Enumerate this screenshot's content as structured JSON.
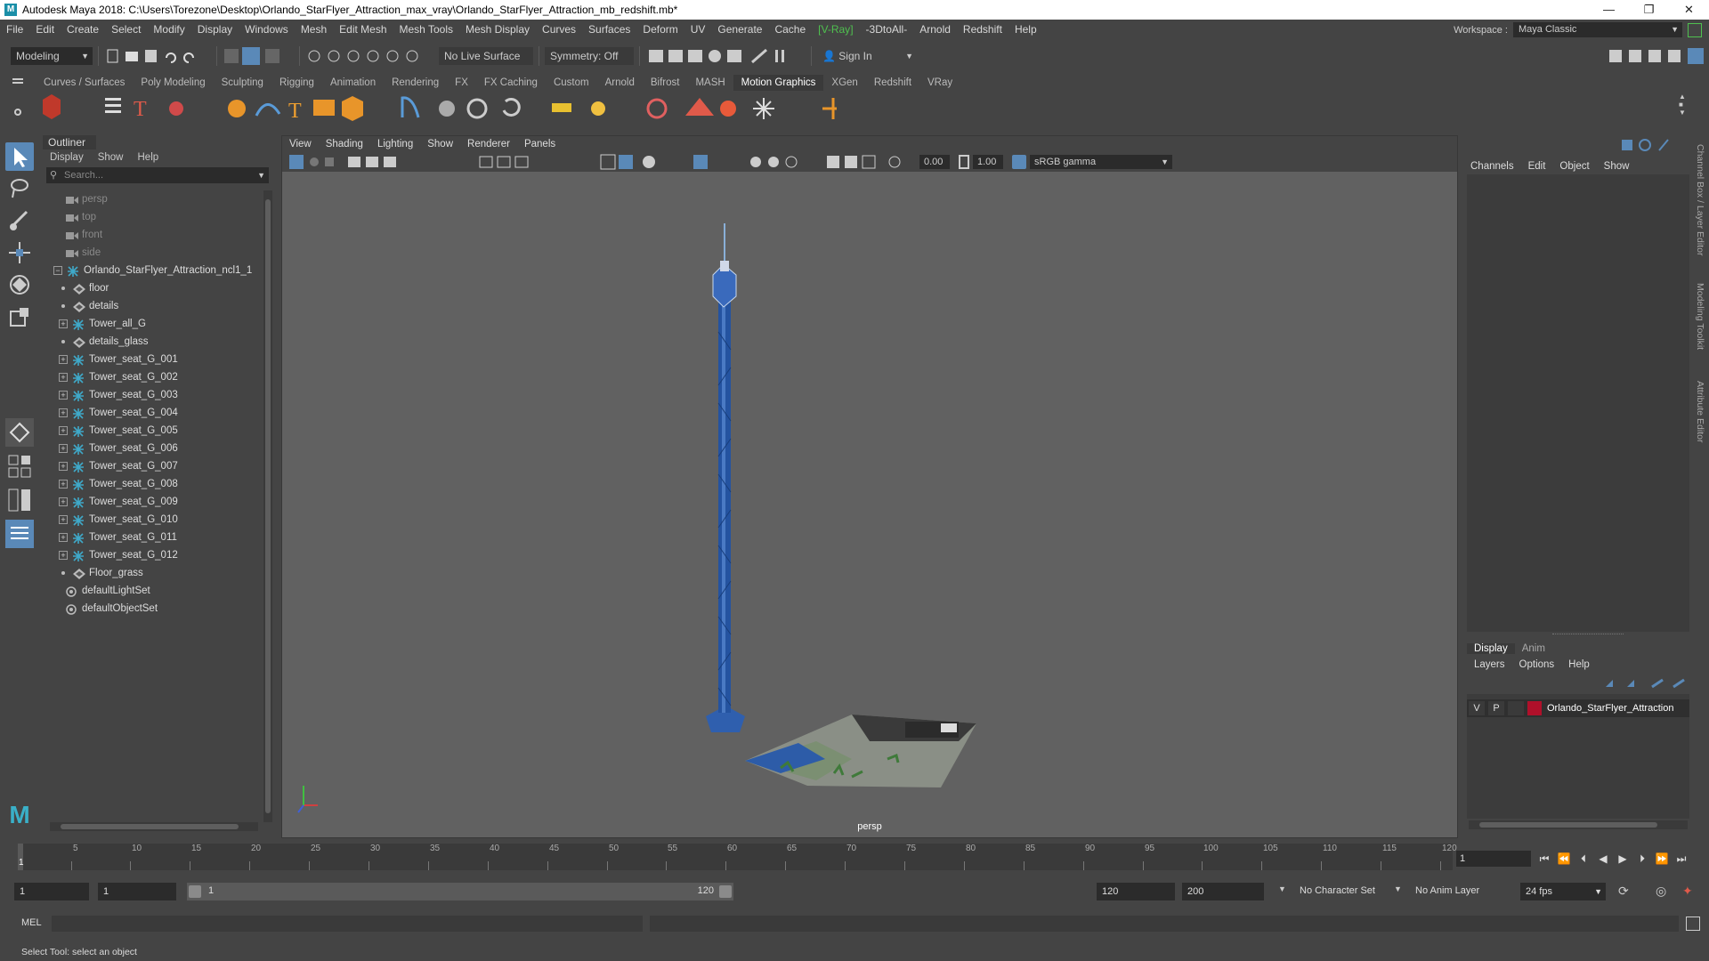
{
  "window": {
    "title": "Autodesk Maya 2018: C:\\Users\\Torezone\\Desktop\\Orlando_StarFlyer_Attraction_max_vray\\Orlando_StarFlyer_Attraction_mb_redshift.mb*",
    "minimize": "—",
    "maximize": "❐",
    "close": "✕"
  },
  "menubar": {
    "items": [
      "File",
      "Edit",
      "Create",
      "Select",
      "Modify",
      "Display",
      "Windows",
      "Mesh",
      "Edit Mesh",
      "Mesh Tools",
      "Mesh Display",
      "Curves",
      "Surfaces",
      "Deform",
      "UV",
      "Generate",
      "Cache",
      "-3DtoAll-",
      "Arnold",
      "Redshift",
      "Help"
    ],
    "vray": "V-Ray",
    "workspace_label": "Workspace :",
    "workspace_value": "Maya Classic"
  },
  "statusline": {
    "mode": "Modeling",
    "live_surface": "No Live Surface",
    "symmetry": "Symmetry: Off",
    "sign_in": "Sign In"
  },
  "shelf": {
    "tabs": [
      "Curves / Surfaces",
      "Poly Modeling",
      "Sculpting",
      "Rigging",
      "Animation",
      "Rendering",
      "FX",
      "FX Caching",
      "Custom",
      "Arnold",
      "Bifrost",
      "MASH",
      "Motion Graphics",
      "XGen",
      "Redshift",
      "VRay"
    ],
    "active_tab": "Motion Graphics"
  },
  "outliner": {
    "title": "Outliner",
    "menu": [
      "Display",
      "Show",
      "Help"
    ],
    "search_placeholder": "Search...",
    "items": [
      {
        "label": "persp",
        "type": "camera",
        "dim": true
      },
      {
        "label": "top",
        "type": "camera",
        "dim": true
      },
      {
        "label": "front",
        "type": "camera",
        "dim": true
      },
      {
        "label": "side",
        "type": "camera",
        "dim": true
      },
      {
        "label": "Orlando_StarFlyer_Attraction_ncl1_1",
        "type": "group",
        "expand": "−"
      },
      {
        "label": "floor",
        "type": "mesh",
        "child": true
      },
      {
        "label": "details",
        "type": "mesh",
        "child": true
      },
      {
        "label": "Tower_all_G",
        "type": "group",
        "child": true,
        "expand": "+"
      },
      {
        "label": "details_glass",
        "type": "mesh",
        "child": true
      },
      {
        "label": "Tower_seat_G_001",
        "type": "group",
        "child": true,
        "expand": "+"
      },
      {
        "label": "Tower_seat_G_002",
        "type": "group",
        "child": true,
        "expand": "+"
      },
      {
        "label": "Tower_seat_G_003",
        "type": "group",
        "child": true,
        "expand": "+"
      },
      {
        "label": "Tower_seat_G_004",
        "type": "group",
        "child": true,
        "expand": "+"
      },
      {
        "label": "Tower_seat_G_005",
        "type": "group",
        "child": true,
        "expand": "+"
      },
      {
        "label": "Tower_seat_G_006",
        "type": "group",
        "child": true,
        "expand": "+"
      },
      {
        "label": "Tower_seat_G_007",
        "type": "group",
        "child": true,
        "expand": "+"
      },
      {
        "label": "Tower_seat_G_008",
        "type": "group",
        "child": true,
        "expand": "+"
      },
      {
        "label": "Tower_seat_G_009",
        "type": "group",
        "child": true,
        "expand": "+"
      },
      {
        "label": "Tower_seat_G_010",
        "type": "group",
        "child": true,
        "expand": "+"
      },
      {
        "label": "Tower_seat_G_011",
        "type": "group",
        "child": true,
        "expand": "+"
      },
      {
        "label": "Tower_seat_G_012",
        "type": "group",
        "child": true,
        "expand": "+"
      },
      {
        "label": "Floor_grass",
        "type": "mesh",
        "child": true
      },
      {
        "label": "defaultLightSet",
        "type": "set"
      },
      {
        "label": "defaultObjectSet",
        "type": "set"
      }
    ]
  },
  "viewport": {
    "menu": [
      "View",
      "Shading",
      "Lighting",
      "Show",
      "Renderer",
      "Panels"
    ],
    "exposure": "0.00",
    "gamma": "1.00",
    "color_space": "sRGB gamma",
    "camera_label": "persp"
  },
  "channelbox": {
    "menu": [
      "Channels",
      "Edit",
      "Object",
      "Show"
    ],
    "layer_tabs": [
      "Display",
      "Anim"
    ],
    "active_layer_tab": "Display",
    "layer_menu": [
      "Layers",
      "Options",
      "Help"
    ],
    "layer": {
      "v": "V",
      "p": "P",
      "name": "Orlando_StarFlyer_Attraction",
      "color": "#b0102a"
    },
    "side_tabs": [
      "Channel Box / Layer Editor",
      "Modeling Toolkit",
      "Attribute Editor"
    ]
  },
  "timeslider": {
    "ticks": [
      "5",
      "10",
      "15",
      "20",
      "25",
      "30",
      "35",
      "40",
      "45",
      "50",
      "55",
      "60",
      "65",
      "70",
      "75",
      "80",
      "85",
      "90",
      "95",
      "100",
      "105",
      "110",
      "115",
      "120"
    ],
    "current_marker": "1",
    "current_frame": "1"
  },
  "rangeslider": {
    "start": "1",
    "anim_start": "1",
    "range_start": "1",
    "range_end": "120",
    "anim_end": "120",
    "end": "200",
    "character_set": "No Character Set",
    "anim_layer": "No Anim Layer",
    "fps": "24 fps"
  },
  "cmdline": {
    "label": "MEL"
  },
  "helpline": {
    "text": "Select Tool: select an object"
  },
  "colors": {
    "panel": "#444444",
    "viewport": "#616161",
    "field": "#2b2b2b",
    "tower": "#1f4f9a",
    "accent_active": "#5a89b8"
  }
}
